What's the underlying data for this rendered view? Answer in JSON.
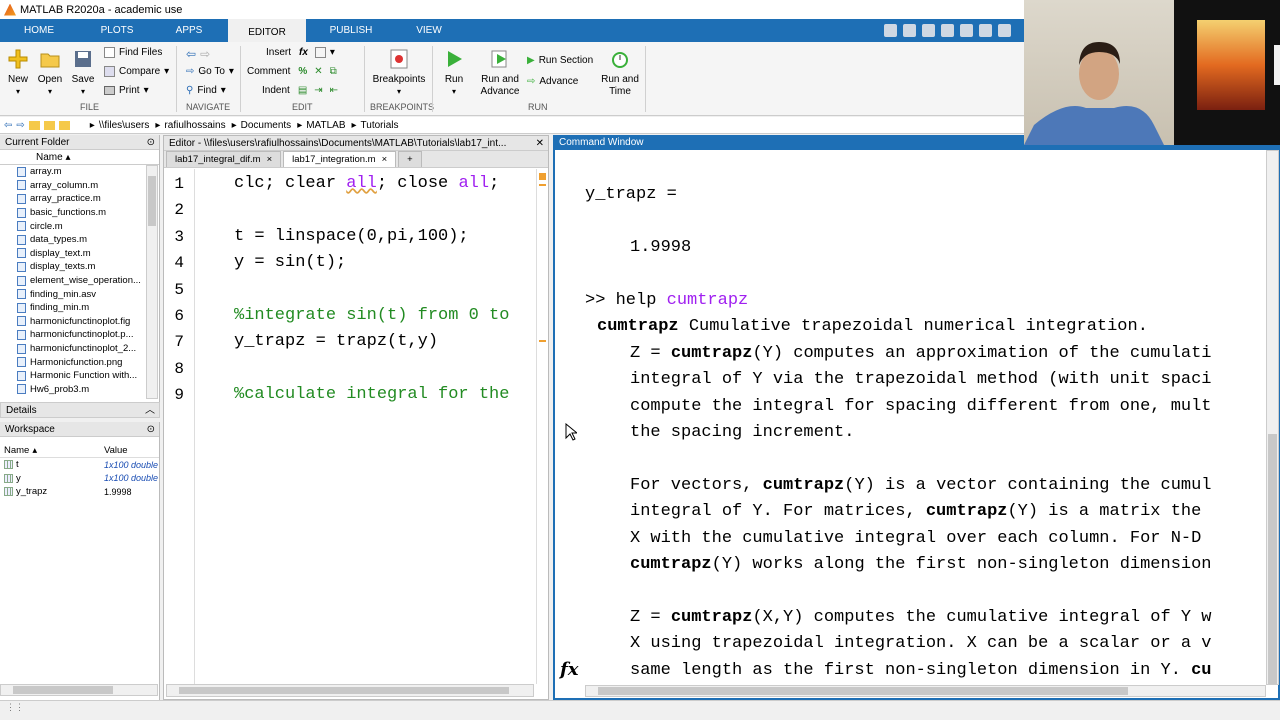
{
  "window": {
    "title": "MATLAB R2020a - academic use"
  },
  "tabs": [
    "HOME",
    "PLOTS",
    "APPS",
    "EDITOR",
    "PUBLISH",
    "VIEW"
  ],
  "ribbon": {
    "file": {
      "new": "New",
      "open": "Open",
      "save": "Save",
      "find_files": "Find Files",
      "compare": "Compare",
      "print": "Print",
      "group": "FILE"
    },
    "navigate": {
      "go_to": "Go To",
      "find": "Find",
      "group": "NAVIGATE"
    },
    "edit": {
      "insert": "Insert",
      "comment": "Comment",
      "indent": "Indent",
      "fx": "fx",
      "percent": "%",
      "group": "EDIT"
    },
    "breakpoints": {
      "label": "Breakpoints",
      "group": "BREAKPOINTS"
    },
    "run": {
      "run": "Run",
      "run_advance": "Run and Advance",
      "run_section": "Run Section",
      "advance": "Advance",
      "run_time": "Run and Time",
      "group": "RUN"
    }
  },
  "address": [
    "\\\\files\\users",
    "rafiulhossains",
    "Documents",
    "MATLAB",
    "Tutorials"
  ],
  "current_folder": {
    "title": "Current Folder",
    "column": "Name",
    "files": [
      "array.m",
      "array_column.m",
      "array_practice.m",
      "basic_functions.m",
      "circle.m",
      "data_types.m",
      "display_text.m",
      "display_texts.m",
      "element_wise_operation...",
      "finding_min.asv",
      "finding_min.m",
      "harmonicfunctinoplot.fig",
      "harmonicfunctinoplot.p...",
      "harmonicfunctinoplot_2...",
      "Harmonicfunction.png",
      "Harmonic Function with...",
      "Hw6_prob3.m"
    ]
  },
  "details": {
    "title": "Details"
  },
  "workspace": {
    "title": "Workspace",
    "col_name": "Name",
    "col_value": "Value",
    "vars": [
      {
        "name": "t",
        "value": "1x100 double"
      },
      {
        "name": "y",
        "value": "1x100 double"
      },
      {
        "name": "y_trapz",
        "value": "1.9998"
      }
    ]
  },
  "editor": {
    "title": "Editor - \\\\files\\users\\rafiulhossains\\Documents\\MATLAB\\Tutorials\\lab17_int...",
    "tab1": "lab17_integral_dif.m",
    "tab2": "lab17_integration.m",
    "close": "×",
    "plus": "+",
    "line_numbers": [
      "1",
      "2",
      "3",
      "4",
      "5",
      "6",
      "7",
      "8",
      "9"
    ],
    "lines": {
      "l1a": "clc; clear ",
      "l1b": "all",
      "l1c": "; close ",
      "l1d": "all",
      "l1e": ";",
      "l3": "t = linspace(0,pi,100);",
      "l4": "y = sin(t);",
      "l6": "%integrate sin(t) from 0 to",
      "l7": "y_trapz = trapz(t,y)",
      "l9": "%calculate integral for the"
    }
  },
  "command_window": {
    "title": "Command Window",
    "out1": "y_trapz =",
    "out2": "1.9998",
    "prompt": ">> help ",
    "prompt_arg": "cumtrapz",
    "h1_b": "cumtrapz",
    "h1": " Cumulative trapezoidal numerical integration.",
    "h2a": "Z = ",
    "h2b": "cumtrapz",
    "h2c": "(Y) computes an approximation of the cumulati",
    "h3": "integral of Y via the trapezoidal method (with unit spaci",
    "h4": "compute the integral for spacing different from one, mult",
    "h5": "the spacing increment.",
    "h6a": "For vectors, ",
    "h6b": "cumtrapz",
    "h6c": "(Y) is a vector containing the cumul",
    "h7a": "integral of Y. For matrices, ",
    "h7b": "cumtrapz",
    "h7c": "(Y) is a matrix the",
    "h8": "X with the cumulative integral over each column. For N-D",
    "h9a": "cumtrapz",
    "h9b": "(Y) works along the first non-singleton dimension",
    "h10a": "Z = ",
    "h10b": "cumtrapz",
    "h10c": "(X,Y) computes the cumulative integral of Y w",
    "h11": "X using trapezoidal integration. X can be a scalar or a v",
    "h12a": "same length as the first non-singleton dimension in Y. ",
    "h12b": "cu",
    "fx": "fx"
  }
}
